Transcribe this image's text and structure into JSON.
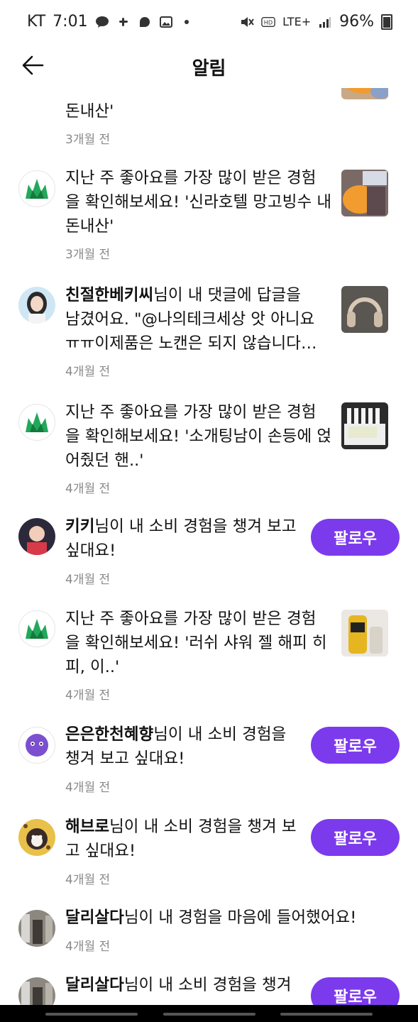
{
  "status_bar": {
    "carrier": "KT",
    "time": "7:01",
    "network": "LTE+",
    "battery": "96%"
  },
  "header": {
    "title": "알림"
  },
  "notifications": [
    {
      "text_line1": "돈내산'",
      "time": "3개월 전"
    },
    {
      "text_line1": "지난 주 좋아요를 가장 많이 받은 경험",
      "text_line2": "을 확인해보세요! '신라호텔 망고빙수 내",
      "text_line3": "돈내산'",
      "time": "3개월 전"
    },
    {
      "user": "친절한베키씨",
      "text_line1_rest": "님이 내 댓글에 답글을",
      "text_line2": "남겼어요. \"@나의테크세상 앗 아니요",
      "text_line3": "ㅠㅠ이제품은 노캔은 되지 않습니다…",
      "time": "4개월 전"
    },
    {
      "text_line1": "지난 주 좋아요를 가장 많이 받은 경험",
      "text_line2": "을 확인해보세요! '소개팅남이 손등에 얹",
      "text_line3": "어줬던 핸..'",
      "time": "4개월 전"
    },
    {
      "user": "키키",
      "text_line1_rest": "님이 내 소비 경험을 챙겨 보고",
      "text_line2": "싶대요!",
      "time": "4개월 전",
      "button": "팔로우"
    },
    {
      "text_line1": "지난 주 좋아요를 가장 많이 받은 경험",
      "text_line2": "을 확인해보세요! '러쉬 샤워 젤 해피 히",
      "text_line3": "피, 이..'",
      "time": "4개월 전"
    },
    {
      "user": "은은한천혜향",
      "text_line1_rest": "님이 내 소비 경험을",
      "text_line2": "챙겨 보고 싶대요!",
      "time": "4개월 전",
      "button": "팔로우"
    },
    {
      "user": "해브로",
      "text_line1_rest": "님이 내 소비 경험을 챙겨 보",
      "text_line2": "고 싶대요!",
      "time": "4개월 전",
      "button": "팔로우"
    },
    {
      "user": "달리살다",
      "text_line1_rest": "님이 내 경험을 마음에 들어했어요!",
      "time": "4개월 전"
    },
    {
      "user": "달리살다",
      "text_line1_rest": "님이 내 소비 경험을 챙겨",
      "button": "팔로우"
    }
  ],
  "colors": {
    "accent": "#7c3aed",
    "time_text": "#8a8a8a",
    "brand_icon": "#22a85a"
  }
}
